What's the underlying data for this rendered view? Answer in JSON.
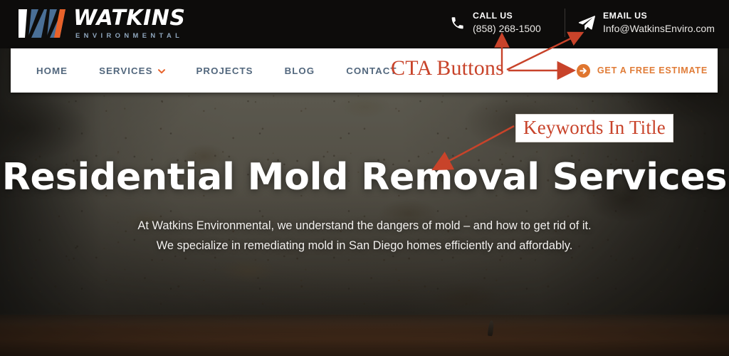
{
  "header": {
    "logo": {
      "word": "WATKINS",
      "sub": "ENVIRONMENTAL",
      "mark_name": "watkins-w-logo-mark"
    },
    "contacts": [
      {
        "icon": "phone-icon",
        "label": "CALL US",
        "value": "(858) 268-1500"
      },
      {
        "icon": "paper-plane-icon",
        "label": "EMAIL US",
        "value": "Info@WatkinsEnviro.com"
      }
    ]
  },
  "nav": {
    "items": [
      {
        "label": "HOME",
        "has_dropdown": false
      },
      {
        "label": "SERVICES",
        "has_dropdown": true
      },
      {
        "label": "PROJECTS",
        "has_dropdown": false
      },
      {
        "label": "BLOG",
        "has_dropdown": false
      },
      {
        "label": "CONTACT",
        "has_dropdown": false
      }
    ],
    "estimate_button": {
      "label": "GET A FREE ESTIMATE",
      "icon": "circle-arrow-right-icon"
    }
  },
  "hero": {
    "title": "Residential Mold Removal Services",
    "subtitle": "At Watkins Environmental, we understand the dangers of mold – and how to get rid of it. We specialize in remediating mold in San Diego homes efficiently and affordably."
  },
  "annotations": [
    {
      "id": "cta-buttons",
      "text": "CTA Buttons"
    },
    {
      "id": "keywords-in-title",
      "text": "Keywords In Title"
    }
  ],
  "colors": {
    "annotation_red": "#c8432a",
    "brand_orange": "#e07b36",
    "nav_text": "#52677d",
    "logo_blue": "#4a6f96",
    "header_dark": "#0d0c0b",
    "nav_bg": "#ffffff"
  }
}
